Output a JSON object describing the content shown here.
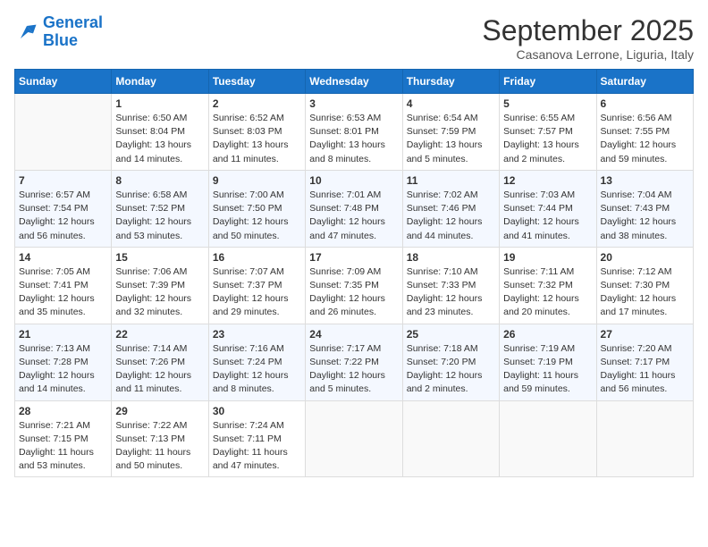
{
  "logo": {
    "line1": "General",
    "line2": "Blue"
  },
  "title": "September 2025",
  "location": "Casanova Lerrone, Liguria, Italy",
  "days_of_week": [
    "Sunday",
    "Monday",
    "Tuesday",
    "Wednesday",
    "Thursday",
    "Friday",
    "Saturday"
  ],
  "weeks": [
    [
      {
        "num": "",
        "info": ""
      },
      {
        "num": "1",
        "info": "Sunrise: 6:50 AM\nSunset: 8:04 PM\nDaylight: 13 hours\nand 14 minutes."
      },
      {
        "num": "2",
        "info": "Sunrise: 6:52 AM\nSunset: 8:03 PM\nDaylight: 13 hours\nand 11 minutes."
      },
      {
        "num": "3",
        "info": "Sunrise: 6:53 AM\nSunset: 8:01 PM\nDaylight: 13 hours\nand 8 minutes."
      },
      {
        "num": "4",
        "info": "Sunrise: 6:54 AM\nSunset: 7:59 PM\nDaylight: 13 hours\nand 5 minutes."
      },
      {
        "num": "5",
        "info": "Sunrise: 6:55 AM\nSunset: 7:57 PM\nDaylight: 13 hours\nand 2 minutes."
      },
      {
        "num": "6",
        "info": "Sunrise: 6:56 AM\nSunset: 7:55 PM\nDaylight: 12 hours\nand 59 minutes."
      }
    ],
    [
      {
        "num": "7",
        "info": "Sunrise: 6:57 AM\nSunset: 7:54 PM\nDaylight: 12 hours\nand 56 minutes."
      },
      {
        "num": "8",
        "info": "Sunrise: 6:58 AM\nSunset: 7:52 PM\nDaylight: 12 hours\nand 53 minutes."
      },
      {
        "num": "9",
        "info": "Sunrise: 7:00 AM\nSunset: 7:50 PM\nDaylight: 12 hours\nand 50 minutes."
      },
      {
        "num": "10",
        "info": "Sunrise: 7:01 AM\nSunset: 7:48 PM\nDaylight: 12 hours\nand 47 minutes."
      },
      {
        "num": "11",
        "info": "Sunrise: 7:02 AM\nSunset: 7:46 PM\nDaylight: 12 hours\nand 44 minutes."
      },
      {
        "num": "12",
        "info": "Sunrise: 7:03 AM\nSunset: 7:44 PM\nDaylight: 12 hours\nand 41 minutes."
      },
      {
        "num": "13",
        "info": "Sunrise: 7:04 AM\nSunset: 7:43 PM\nDaylight: 12 hours\nand 38 minutes."
      }
    ],
    [
      {
        "num": "14",
        "info": "Sunrise: 7:05 AM\nSunset: 7:41 PM\nDaylight: 12 hours\nand 35 minutes."
      },
      {
        "num": "15",
        "info": "Sunrise: 7:06 AM\nSunset: 7:39 PM\nDaylight: 12 hours\nand 32 minutes."
      },
      {
        "num": "16",
        "info": "Sunrise: 7:07 AM\nSunset: 7:37 PM\nDaylight: 12 hours\nand 29 minutes."
      },
      {
        "num": "17",
        "info": "Sunrise: 7:09 AM\nSunset: 7:35 PM\nDaylight: 12 hours\nand 26 minutes."
      },
      {
        "num": "18",
        "info": "Sunrise: 7:10 AM\nSunset: 7:33 PM\nDaylight: 12 hours\nand 23 minutes."
      },
      {
        "num": "19",
        "info": "Sunrise: 7:11 AM\nSunset: 7:32 PM\nDaylight: 12 hours\nand 20 minutes."
      },
      {
        "num": "20",
        "info": "Sunrise: 7:12 AM\nSunset: 7:30 PM\nDaylight: 12 hours\nand 17 minutes."
      }
    ],
    [
      {
        "num": "21",
        "info": "Sunrise: 7:13 AM\nSunset: 7:28 PM\nDaylight: 12 hours\nand 14 minutes."
      },
      {
        "num": "22",
        "info": "Sunrise: 7:14 AM\nSunset: 7:26 PM\nDaylight: 12 hours\nand 11 minutes."
      },
      {
        "num": "23",
        "info": "Sunrise: 7:16 AM\nSunset: 7:24 PM\nDaylight: 12 hours\nand 8 minutes."
      },
      {
        "num": "24",
        "info": "Sunrise: 7:17 AM\nSunset: 7:22 PM\nDaylight: 12 hours\nand 5 minutes."
      },
      {
        "num": "25",
        "info": "Sunrise: 7:18 AM\nSunset: 7:20 PM\nDaylight: 12 hours\nand 2 minutes."
      },
      {
        "num": "26",
        "info": "Sunrise: 7:19 AM\nSunset: 7:19 PM\nDaylight: 11 hours\nand 59 minutes."
      },
      {
        "num": "27",
        "info": "Sunrise: 7:20 AM\nSunset: 7:17 PM\nDaylight: 11 hours\nand 56 minutes."
      }
    ],
    [
      {
        "num": "28",
        "info": "Sunrise: 7:21 AM\nSunset: 7:15 PM\nDaylight: 11 hours\nand 53 minutes."
      },
      {
        "num": "29",
        "info": "Sunrise: 7:22 AM\nSunset: 7:13 PM\nDaylight: 11 hours\nand 50 minutes."
      },
      {
        "num": "30",
        "info": "Sunrise: 7:24 AM\nSunset: 7:11 PM\nDaylight: 11 hours\nand 47 minutes."
      },
      {
        "num": "",
        "info": ""
      },
      {
        "num": "",
        "info": ""
      },
      {
        "num": "",
        "info": ""
      },
      {
        "num": "",
        "info": ""
      }
    ]
  ]
}
